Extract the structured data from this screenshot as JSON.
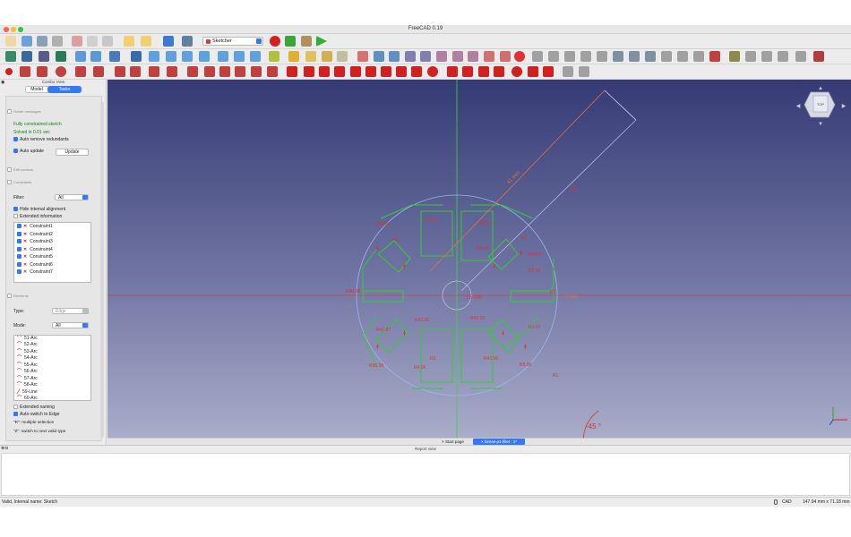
{
  "app": {
    "title": "FreeCAD 0.19"
  },
  "toolbar": {
    "workbench": "Sketcher"
  },
  "combo": {
    "title": "Combo View",
    "tabs": [
      "Model",
      "Tasks"
    ],
    "solver_section": "Solver messages",
    "solver_status": "Fully constrained sketch",
    "solved_time": "Solved in 0.01 sec",
    "auto_remove": "Auto remove redundants",
    "auto_update": "Auto update",
    "update_button": "Update",
    "edit_controls": "Edit controls",
    "constraints_section": "Constraints",
    "filter_label": "Filter:",
    "filter_value": "All",
    "hide_internal": "Hide internal alignment",
    "extended_info": "Extended information",
    "constraints": [
      "Constraint1",
      "Constraint2",
      "Constraint3",
      "Constraint4",
      "Constraint5",
      "Constraint6",
      "Constraint7"
    ],
    "elements_section": "Elements",
    "type_label": "Type:",
    "type_value": "Edge",
    "mode_label": "Mode:",
    "mode_value": "All",
    "elements": [
      "51-Arc",
      "52-Arc",
      "53-Arc",
      "54-Arc",
      "55-Arc",
      "56-Arc",
      "57-Arc",
      "58-Arc",
      "59-Line",
      "60-Arc"
    ],
    "extended_naming": "Extended naming",
    "auto_switch": "Auto-switch to Edge",
    "hint_r": "\"R\": multiple selection",
    "hint_z": "\"Z\": switch to next valid type"
  },
  "viewport": {
    "dims": [
      "41 mm",
      "75 mm",
      "-45 °",
      "70 mm",
      "50"
    ],
    "navcube_face": "TOP"
  },
  "doc_tabs": [
    "Start page",
    "bimas-p1-fillet : 1*"
  ],
  "report": {
    "title": "Report view"
  },
  "status": {
    "message": "Valid, Internal name: Sketch",
    "nav": "CAD",
    "dimension": "147.94 mm x 71.18 mm"
  },
  "colors": {
    "constraint": "#d62828",
    "geometry": "#22cc22",
    "accent": "#3478f6"
  }
}
